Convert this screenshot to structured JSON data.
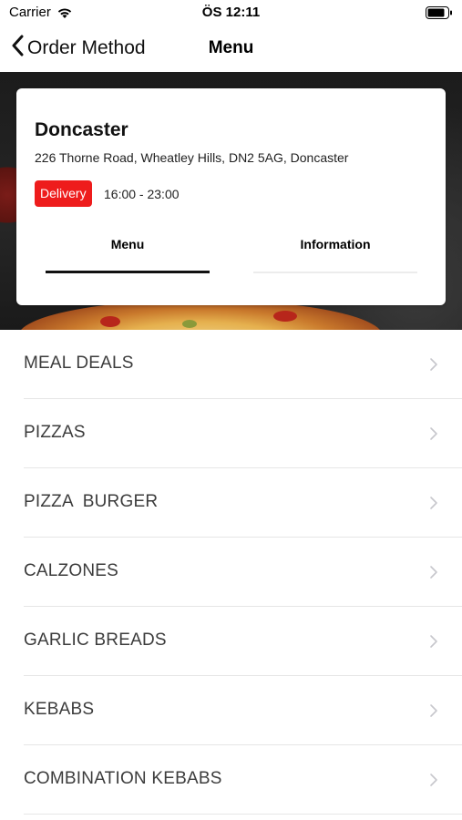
{
  "status_bar": {
    "carrier": "Carrier",
    "time": "ÖS 12:11"
  },
  "nav": {
    "back_label": "Order Method",
    "title": "Menu"
  },
  "store": {
    "name": "Doncaster",
    "address": "226 Thorne Road, Wheatley Hills, DN2 5AG, Doncaster",
    "badge": "Delivery",
    "hours": "16:00 - 23:00",
    "tabs": [
      {
        "label": "Menu",
        "active": true
      },
      {
        "label": "Information",
        "active": false
      }
    ]
  },
  "colors": {
    "badge": "#ee1c1c",
    "active_tab": "#111111",
    "row_text": "#3c3c3c"
  },
  "categories": [
    {
      "label": "MEAL DEALS"
    },
    {
      "label": "PIZZAS"
    },
    {
      "label": "PIZZA  BURGER"
    },
    {
      "label": "CALZONES"
    },
    {
      "label": "GARLIC BREADS"
    },
    {
      "label": "KEBABS"
    },
    {
      "label": "COMBINATION KEBABS"
    }
  ]
}
